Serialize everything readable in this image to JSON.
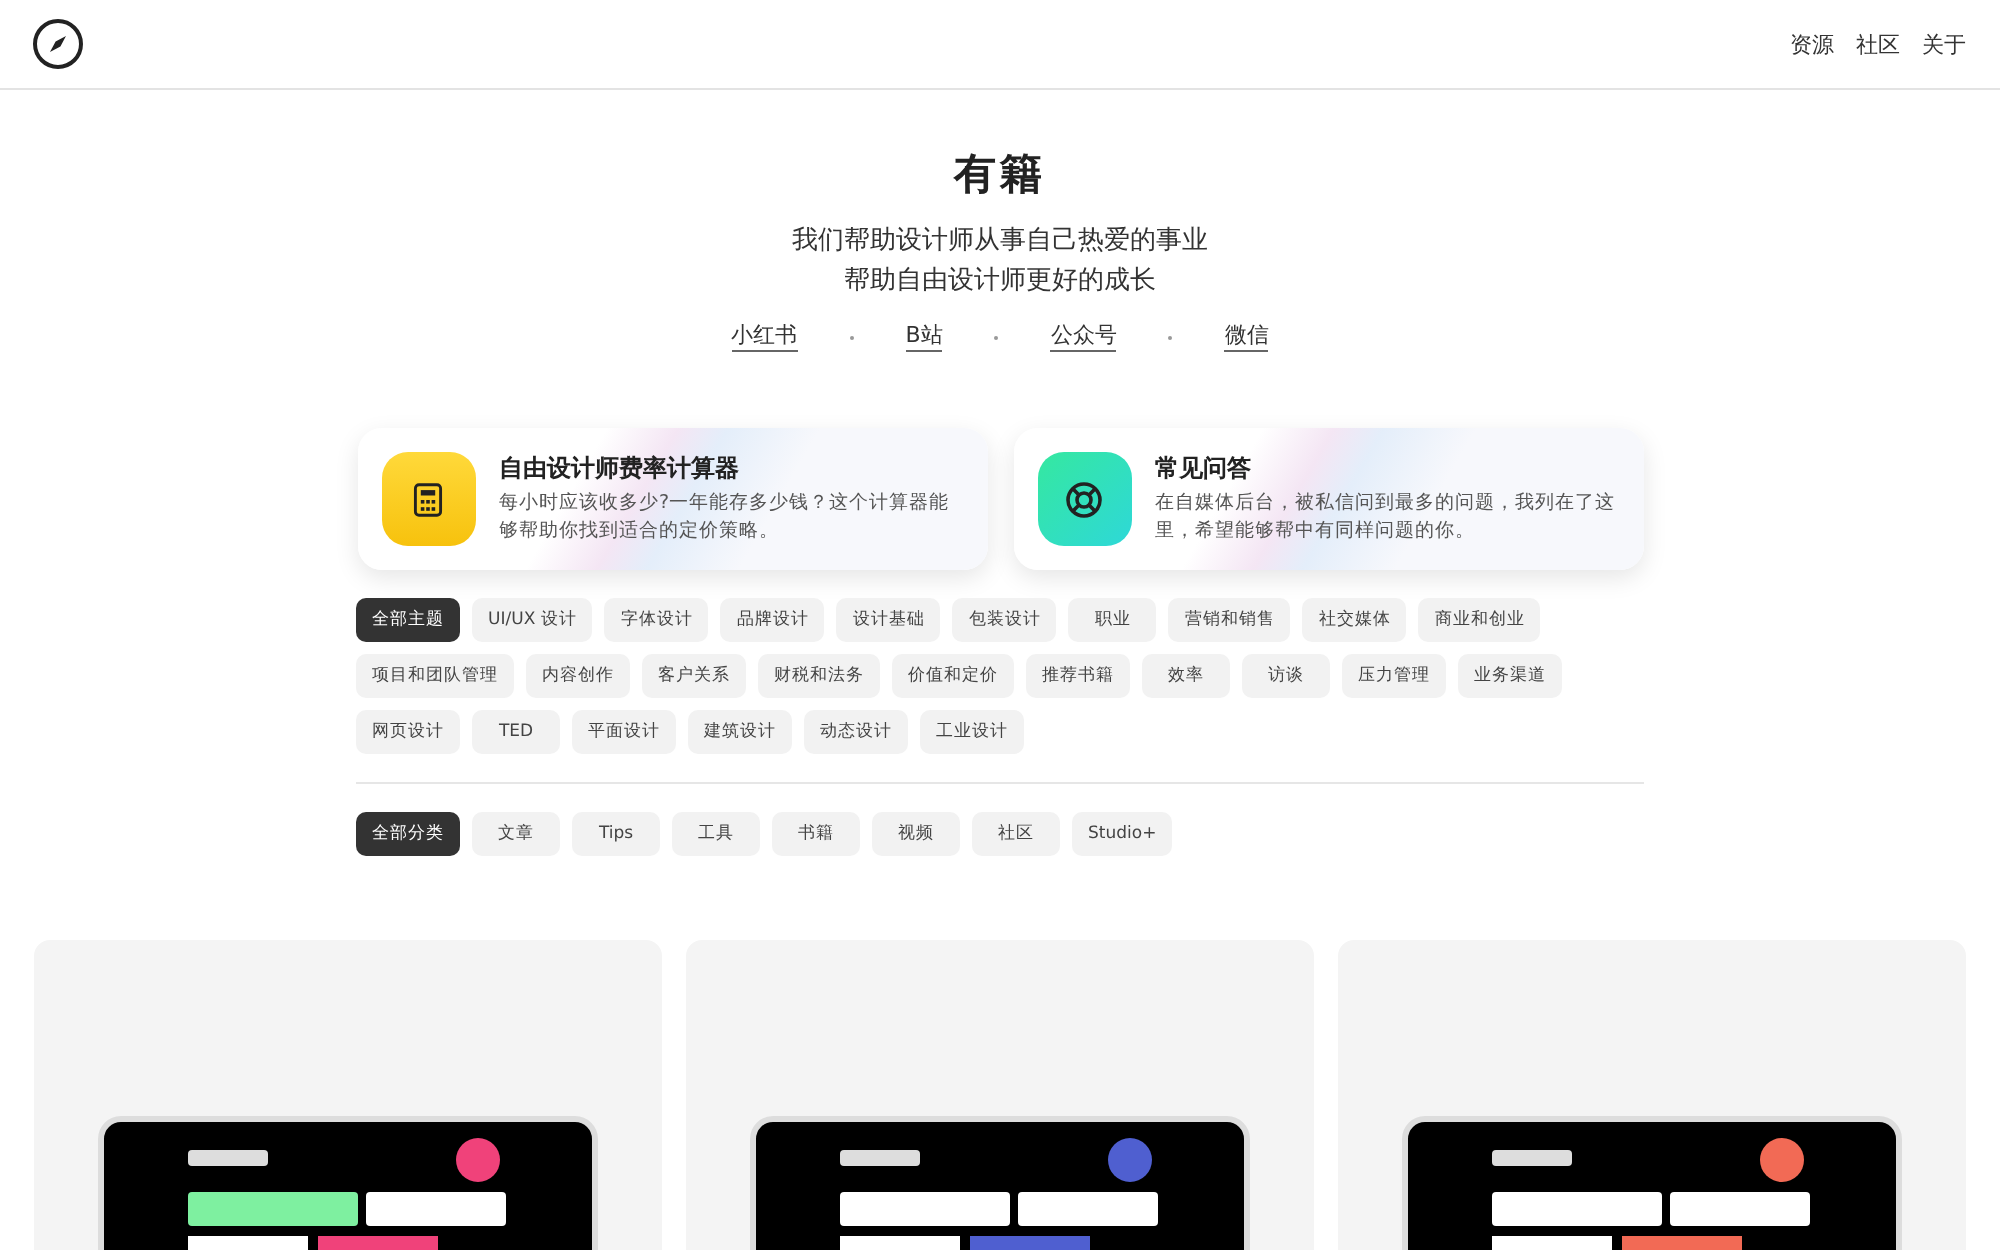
{
  "nav": {
    "links": [
      "资源",
      "社区",
      "关于"
    ]
  },
  "hero": {
    "title": "有籍",
    "subtitle": [
      "我们帮助设计师从事自己热爱的事业",
      "帮助自由设计师更好的成长"
    ],
    "social": [
      "小红书",
      "B站",
      "公众号",
      "微信"
    ]
  },
  "features": [
    {
      "kind": "calculator",
      "title": "自由设计师费率计算器",
      "text": "每小时应该收多少?一年能存多少钱？这个计算器能够帮助你找到适合的定价策略。"
    },
    {
      "kind": "lifebuoy",
      "title": "常见问答",
      "text": "在自媒体后台，被私信问到最多的问题，我列在了这里，希望能够帮中有同样问题的你。"
    }
  ],
  "topics": [
    {
      "label": "全部主题",
      "selected": true
    },
    {
      "label": "UI/UX 设计",
      "selected": false
    },
    {
      "label": "字体设计",
      "selected": false
    },
    {
      "label": "品牌设计",
      "selected": false
    },
    {
      "label": "设计基础",
      "selected": false
    },
    {
      "label": "包装设计",
      "selected": false
    },
    {
      "label": "职业",
      "selected": false
    },
    {
      "label": "营销和销售",
      "selected": false
    },
    {
      "label": "社交媒体",
      "selected": false
    },
    {
      "label": "商业和创业",
      "selected": false
    },
    {
      "label": "项目和团队管理",
      "selected": false
    },
    {
      "label": "内容创作",
      "selected": false
    },
    {
      "label": "客户关系",
      "selected": false
    },
    {
      "label": "财税和法务",
      "selected": false
    },
    {
      "label": "价值和定价",
      "selected": false
    },
    {
      "label": "推荐书籍",
      "selected": false
    },
    {
      "label": "效率",
      "selected": false
    },
    {
      "label": "访谈",
      "selected": false
    },
    {
      "label": "压力管理",
      "selected": false
    },
    {
      "label": "业务渠道",
      "selected": false
    },
    {
      "label": "网页设计",
      "selected": false
    },
    {
      "label": "TED",
      "selected": false
    },
    {
      "label": "平面设计",
      "selected": false
    },
    {
      "label": "建筑设计",
      "selected": false
    },
    {
      "label": "动态设计",
      "selected": false
    },
    {
      "label": "工业设计",
      "selected": false
    }
  ],
  "categories": [
    {
      "label": "全部分类",
      "selected": true
    },
    {
      "label": "文章",
      "selected": false
    },
    {
      "label": "Tips",
      "selected": false
    },
    {
      "label": "工具",
      "selected": false
    },
    {
      "label": "书籍",
      "selected": false
    },
    {
      "label": "视频",
      "selected": false
    },
    {
      "label": "社区",
      "selected": false
    },
    {
      "label": "Studio+",
      "selected": false
    }
  ]
}
